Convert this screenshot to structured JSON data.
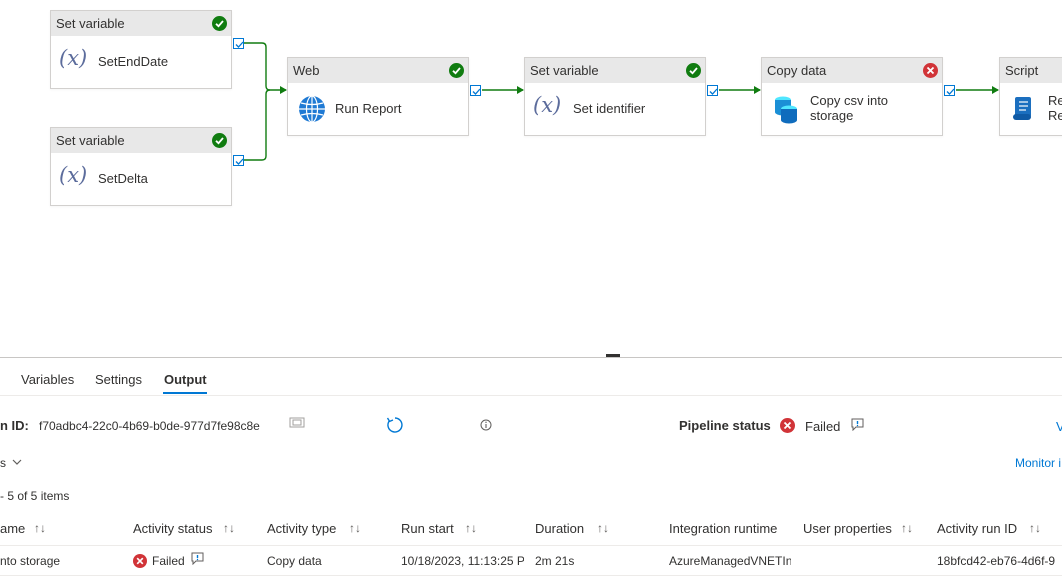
{
  "pipeline": {
    "nodes": [
      {
        "type": "Set variable",
        "label": "SetEndDate",
        "status": "succeeded"
      },
      {
        "type": "Set variable",
        "label": "SetDelta",
        "status": "succeeded"
      },
      {
        "type": "Web",
        "label": "Run Report",
        "status": "succeeded"
      },
      {
        "type": "Set variable",
        "label": "Set identifier",
        "status": "succeeded"
      },
      {
        "type": "Copy data",
        "label_line1": "Copy csv into",
        "label_line2": "storage",
        "status": "failed"
      },
      {
        "type": "Script",
        "label_line1": "Re",
        "label_line2": "Re",
        "status": "unknown"
      }
    ],
    "variable_icon_text": "(𝑥)"
  },
  "tabs": [
    "Variables",
    "Settings",
    "Output"
  ],
  "active_tab": "Output",
  "run": {
    "id_label": "n ID:",
    "id_value": "f70adbc4-22c0-4b69-b0de-977d7fe98c8e",
    "status_label": "Pipeline status",
    "status_value": "Failed",
    "right_partial": "V",
    "monitor_partial": "Monitor i",
    "filter_partial": "s",
    "items_count": "- 5 of 5 items"
  },
  "table": {
    "headers": [
      "ame",
      "Activity status",
      "Activity type",
      "Run start",
      "Duration",
      "Integration runtime",
      "User properties",
      "Activity run ID"
    ],
    "rows": [
      {
        "name": "nto storage",
        "status": "Failed",
        "type": "Copy data",
        "run_start": "10/18/2023, 11:13:25 P",
        "duration": "2m 21s",
        "runtime": "AzureManagedVNETIn",
        "user_properties": "",
        "run_id": "18bfcd42-eb76-4d6f-9"
      }
    ]
  },
  "colors": {
    "success": "#107c10",
    "error": "#d13438",
    "accent": "#0078d4",
    "edge": "#107c10"
  }
}
